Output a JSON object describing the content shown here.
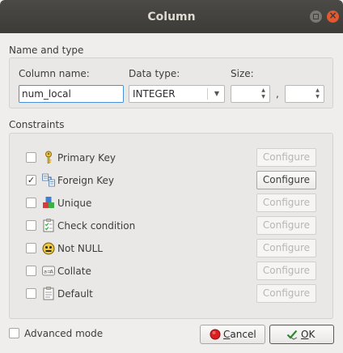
{
  "window": {
    "title": "Column",
    "close_glyph": "×"
  },
  "name_type": {
    "section_title": "Name and type",
    "column_name_label": "Column name:",
    "column_name_value": "num_local",
    "data_type_label": "Data type:",
    "data_type_value": "INTEGER",
    "size_label": "Size:",
    "size_separator": ","
  },
  "constraints": {
    "section_title": "Constraints",
    "items": [
      {
        "label": "Primary Key",
        "checked": false,
        "icon": "key-icon",
        "configure": "Configure",
        "configure_enabled": false
      },
      {
        "label": "Foreign Key",
        "checked": true,
        "icon": "foreign-key-icon",
        "configure": "Configure",
        "configure_enabled": true
      },
      {
        "label": "Unique",
        "checked": false,
        "icon": "unique-icon",
        "configure": "Configure",
        "configure_enabled": false
      },
      {
        "label": "Check condition",
        "checked": false,
        "icon": "check-condition-icon",
        "configure": "Configure",
        "configure_enabled": false
      },
      {
        "label": "Not NULL",
        "checked": false,
        "icon": "not-null-icon",
        "configure": "Configure",
        "configure_enabled": false
      },
      {
        "label": "Collate",
        "checked": false,
        "icon": "collate-icon",
        "configure": "Configure",
        "configure_enabled": false
      },
      {
        "label": "Default",
        "checked": false,
        "icon": "default-icon",
        "configure": "Configure",
        "configure_enabled": false
      }
    ]
  },
  "footer": {
    "advanced_mode_label": "Advanced mode",
    "advanced_mode_checked": false,
    "cancel_first": "C",
    "cancel_rest": "ancel",
    "ok_first": "O",
    "ok_rest": "K"
  },
  "colors": {
    "titlebar": "#3c3b37",
    "close_button": "#e4572f",
    "focus_border": "#4a90d9"
  }
}
